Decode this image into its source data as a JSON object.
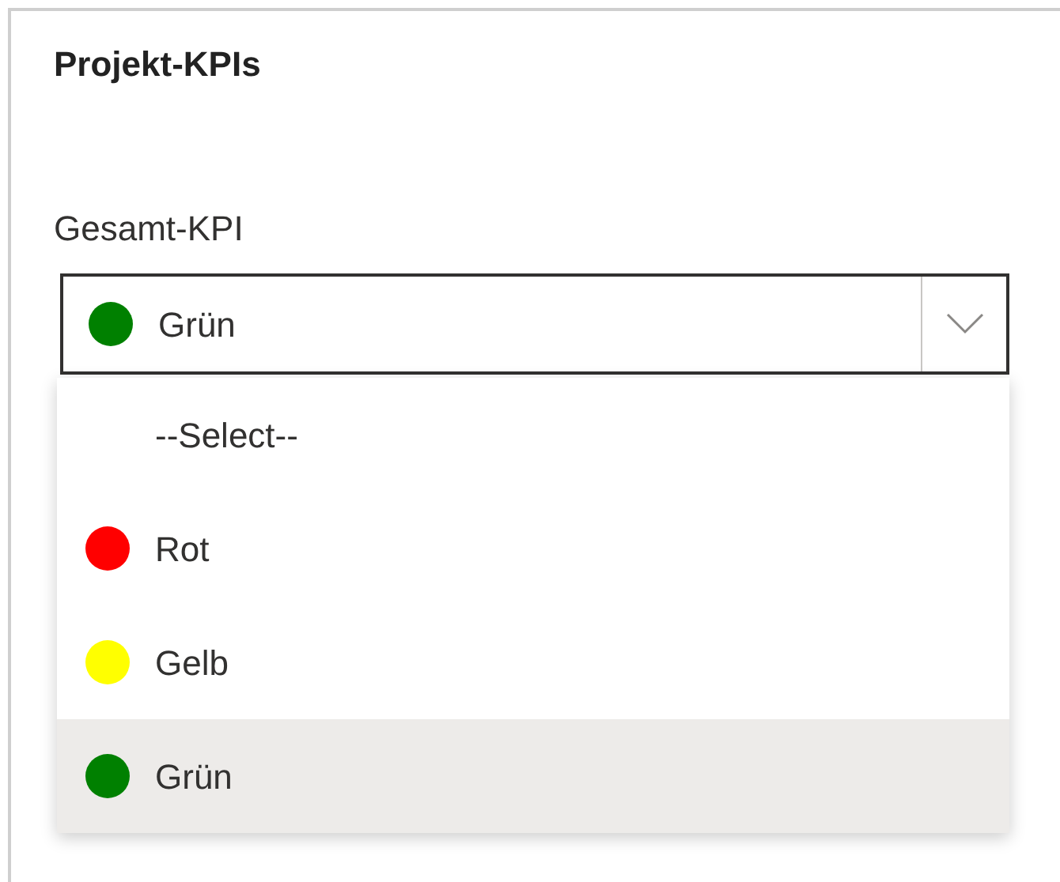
{
  "card": {
    "title": "Projekt-KPIs"
  },
  "field": {
    "label": "Gesamt-KPI",
    "value": "Grün",
    "color": "#008000",
    "expanded": true
  },
  "options": [
    {
      "label": "--Select--",
      "selected": false
    },
    {
      "label": "Rot",
      "color": "#ff0000",
      "selected": false
    },
    {
      "label": "Gelb",
      "color": "#ffff00",
      "selected": false
    },
    {
      "label": "Grün",
      "color": "#008000",
      "selected": true
    }
  ]
}
